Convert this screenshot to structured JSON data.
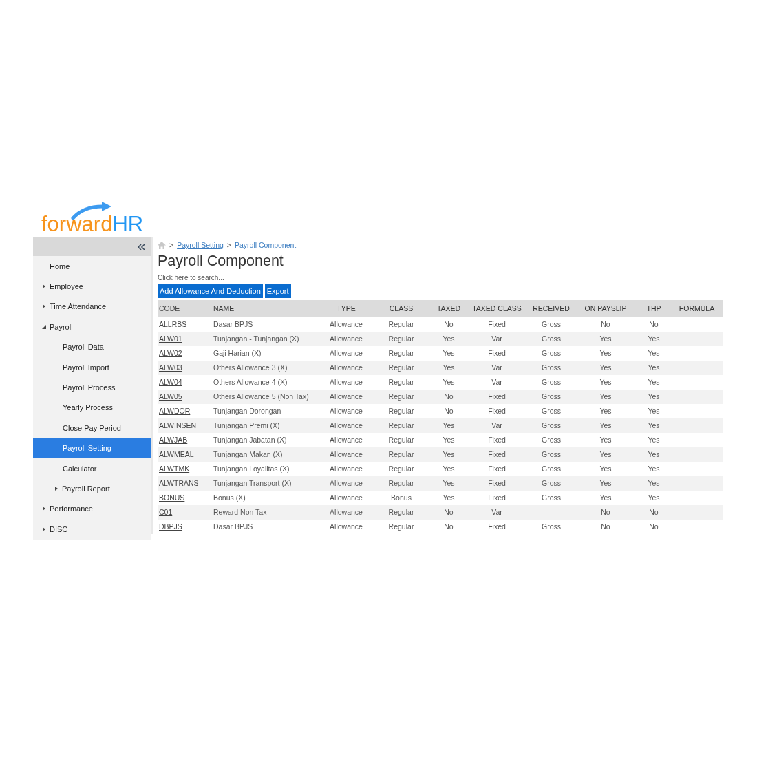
{
  "logo": {
    "prefix": "forward",
    "suffix": "HR"
  },
  "sidebar": {
    "items": [
      {
        "label": "Home",
        "selected": false
      },
      {
        "label": "Employee",
        "selected": false,
        "expanded": false
      },
      {
        "label": "Time Attendance",
        "selected": false,
        "expanded": false
      },
      {
        "label": "Payroll",
        "selected": false,
        "expanded": true,
        "children": [
          {
            "label": "Payroll Data",
            "selected": false
          },
          {
            "label": "Payroll Import",
            "selected": false
          },
          {
            "label": "Payroll Process",
            "selected": false
          },
          {
            "label": "Yearly Process",
            "selected": false
          },
          {
            "label": "Close Pay Period",
            "selected": false
          },
          {
            "label": "Payroll Setting",
            "selected": true
          },
          {
            "label": "Calculator",
            "selected": false
          },
          {
            "label": "Payroll Report",
            "selected": false,
            "expanded": false
          }
        ]
      },
      {
        "label": "Performance",
        "selected": false,
        "expanded": false
      },
      {
        "label": "DISC",
        "selected": false,
        "expanded": false
      }
    ]
  },
  "breadcrumb": [
    {
      "separator": ">",
      "label": "Payroll Setting",
      "kind": "link"
    },
    {
      "separator": ">",
      "label": "Payroll Component",
      "kind": "current"
    }
  ],
  "page_title": "Payroll Component",
  "search": {
    "placeholder": "Click here to search..."
  },
  "buttons": [
    "Add Allowance And Deduction",
    "Export"
  ],
  "table": {
    "columns": [
      {
        "label": "CODE",
        "kind": "link"
      },
      {
        "label": "NAME",
        "kind": "left"
      },
      {
        "label": "TYPE",
        "kind": "center"
      },
      {
        "label": "CLASS",
        "kind": "center"
      },
      {
        "label": "TAXED",
        "kind": "center"
      },
      {
        "label": "TAXED CLASS",
        "kind": "center"
      },
      {
        "label": "RECEIVED",
        "kind": "center"
      },
      {
        "label": "ON PAYSLIP",
        "kind": "center"
      },
      {
        "label": "THP",
        "kind": "center"
      },
      {
        "label": "FORMULA",
        "kind": "center"
      }
    ],
    "rows": [
      [
        "ALLRBS",
        "Dasar BPJS",
        "Allowance",
        "Regular",
        "No",
        "Fixed",
        "Gross",
        "No",
        "No"
      ],
      [
        "ALW01",
        "Tunjangan - Tunjangan (X)",
        "Allowance",
        "Regular",
        "Yes",
        "Var",
        "Gross",
        "Yes",
        "Yes"
      ],
      [
        "ALW02",
        "Gaji Harian (X)",
        "Allowance",
        "Regular",
        "Yes",
        "Fixed",
        "Gross",
        "Yes",
        "Yes"
      ],
      [
        "ALW03",
        "Others Allowance 3 (X)",
        "Allowance",
        "Regular",
        "Yes",
        "Var",
        "Gross",
        "Yes",
        "Yes"
      ],
      [
        "ALW04",
        "Others Allowance 4 (X)",
        "Allowance",
        "Regular",
        "Yes",
        "Var",
        "Gross",
        "Yes",
        "Yes"
      ],
      [
        "ALW05",
        "Others Allowance 5 (Non Tax)",
        "Allowance",
        "Regular",
        "No",
        "Fixed",
        "Gross",
        "Yes",
        "Yes"
      ],
      [
        "ALWDOR",
        "Tunjangan Dorongan",
        "Allowance",
        "Regular",
        "No",
        "Fixed",
        "Gross",
        "Yes",
        "Yes"
      ],
      [
        "ALWINSEN",
        "Tunjangan Premi (X)",
        "Allowance",
        "Regular",
        "Yes",
        "Var",
        "Gross",
        "Yes",
        "Yes"
      ],
      [
        "ALWJAB",
        "Tunjangan Jabatan (X)",
        "Allowance",
        "Regular",
        "Yes",
        "Fixed",
        "Gross",
        "Yes",
        "Yes"
      ],
      [
        "ALWMEAL",
        "Tunjangan Makan (X)",
        "Allowance",
        "Regular",
        "Yes",
        "Fixed",
        "Gross",
        "Yes",
        "Yes"
      ],
      [
        "ALWTMK",
        "Tunjangan Loyalitas (X)",
        "Allowance",
        "Regular",
        "Yes",
        "Fixed",
        "Gross",
        "Yes",
        "Yes"
      ],
      [
        "ALWTRANS",
        "Tunjangan Transport (X)",
        "Allowance",
        "Regular",
        "Yes",
        "Fixed",
        "Gross",
        "Yes",
        "Yes"
      ],
      [
        "BONUS",
        "Bonus (X)",
        "Allowance",
        "Bonus",
        "Yes",
        "Fixed",
        "Gross",
        "Yes",
        "Yes"
      ],
      [
        "C01",
        "Reward Non Tax",
        "Allowance",
        "Regular",
        "No",
        "Var",
        null,
        "No",
        "No"
      ],
      [
        "DBPJS",
        "Dasar BPJS",
        "Allowance",
        "Regular",
        "No",
        "Fixed",
        "Gross",
        "No",
        "No"
      ]
    ]
  }
}
